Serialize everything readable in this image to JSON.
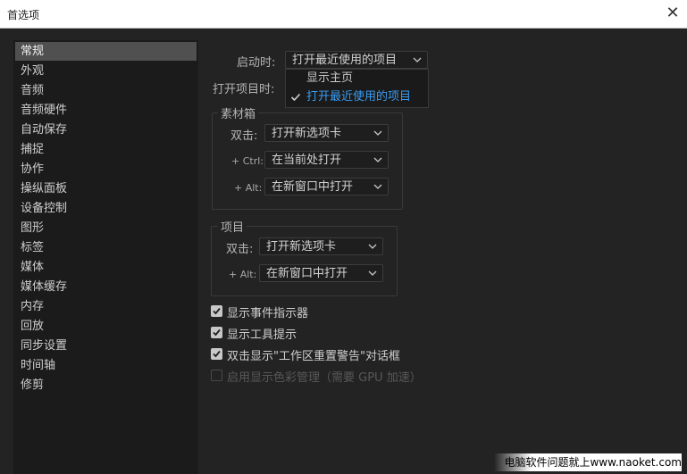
{
  "window": {
    "title": "首选项"
  },
  "sidebar": {
    "items": [
      {
        "label": "常规",
        "selected": true
      },
      {
        "label": "外观"
      },
      {
        "label": "音频"
      },
      {
        "label": "音频硬件"
      },
      {
        "label": "自动保存"
      },
      {
        "label": "捕捉"
      },
      {
        "label": "协作"
      },
      {
        "label": "操纵面板"
      },
      {
        "label": "设备控制"
      },
      {
        "label": "图形"
      },
      {
        "label": "标签"
      },
      {
        "label": "媒体"
      },
      {
        "label": "媒体缓存"
      },
      {
        "label": "内存"
      },
      {
        "label": "回放"
      },
      {
        "label": "同步设置"
      },
      {
        "label": "时间轴"
      },
      {
        "label": "修剪"
      }
    ]
  },
  "general": {
    "startup_label": "启动时:",
    "startup_value": "打开最近使用的项目",
    "open_project_label": "打开项目时:",
    "startup_options": [
      {
        "label": "显示主页",
        "checked": false
      },
      {
        "label": "打开最近使用的项目",
        "checked": true
      }
    ],
    "bins": {
      "title": "素材箱",
      "double_click_label": "双击:",
      "double_click_value": "打开新选项卡",
      "ctrl_label": "+ Ctrl:",
      "ctrl_value": "在当前处打开",
      "alt_label": "+ Alt:",
      "alt_value": "在新窗口中打开"
    },
    "project": {
      "title": "项目",
      "double_click_label": "双击:",
      "double_click_value": "打开新选项卡",
      "alt_label": "+ Alt:",
      "alt_value": "在新窗口中打开"
    },
    "checkboxes": [
      {
        "label": "显示事件指示器",
        "checked": true,
        "enabled": true
      },
      {
        "label": "显示工具提示",
        "checked": true,
        "enabled": true
      },
      {
        "label": "双击显示\"工作区重置警告\"对话框",
        "checked": true,
        "enabled": true
      },
      {
        "label": "启用显示色彩管理（需要 GPU 加速）",
        "checked": false,
        "enabled": false
      }
    ]
  },
  "watermark": {
    "text": "电脑软件问题就上www.naoket.com"
  },
  "colors": {
    "accent": "#3b9bf0",
    "background": "#232323",
    "sidebar": "#1b1b1b",
    "selected": "#505050"
  },
  "icons": [
    "close-icon",
    "chevron-down-icon",
    "checkmark-icon"
  ]
}
